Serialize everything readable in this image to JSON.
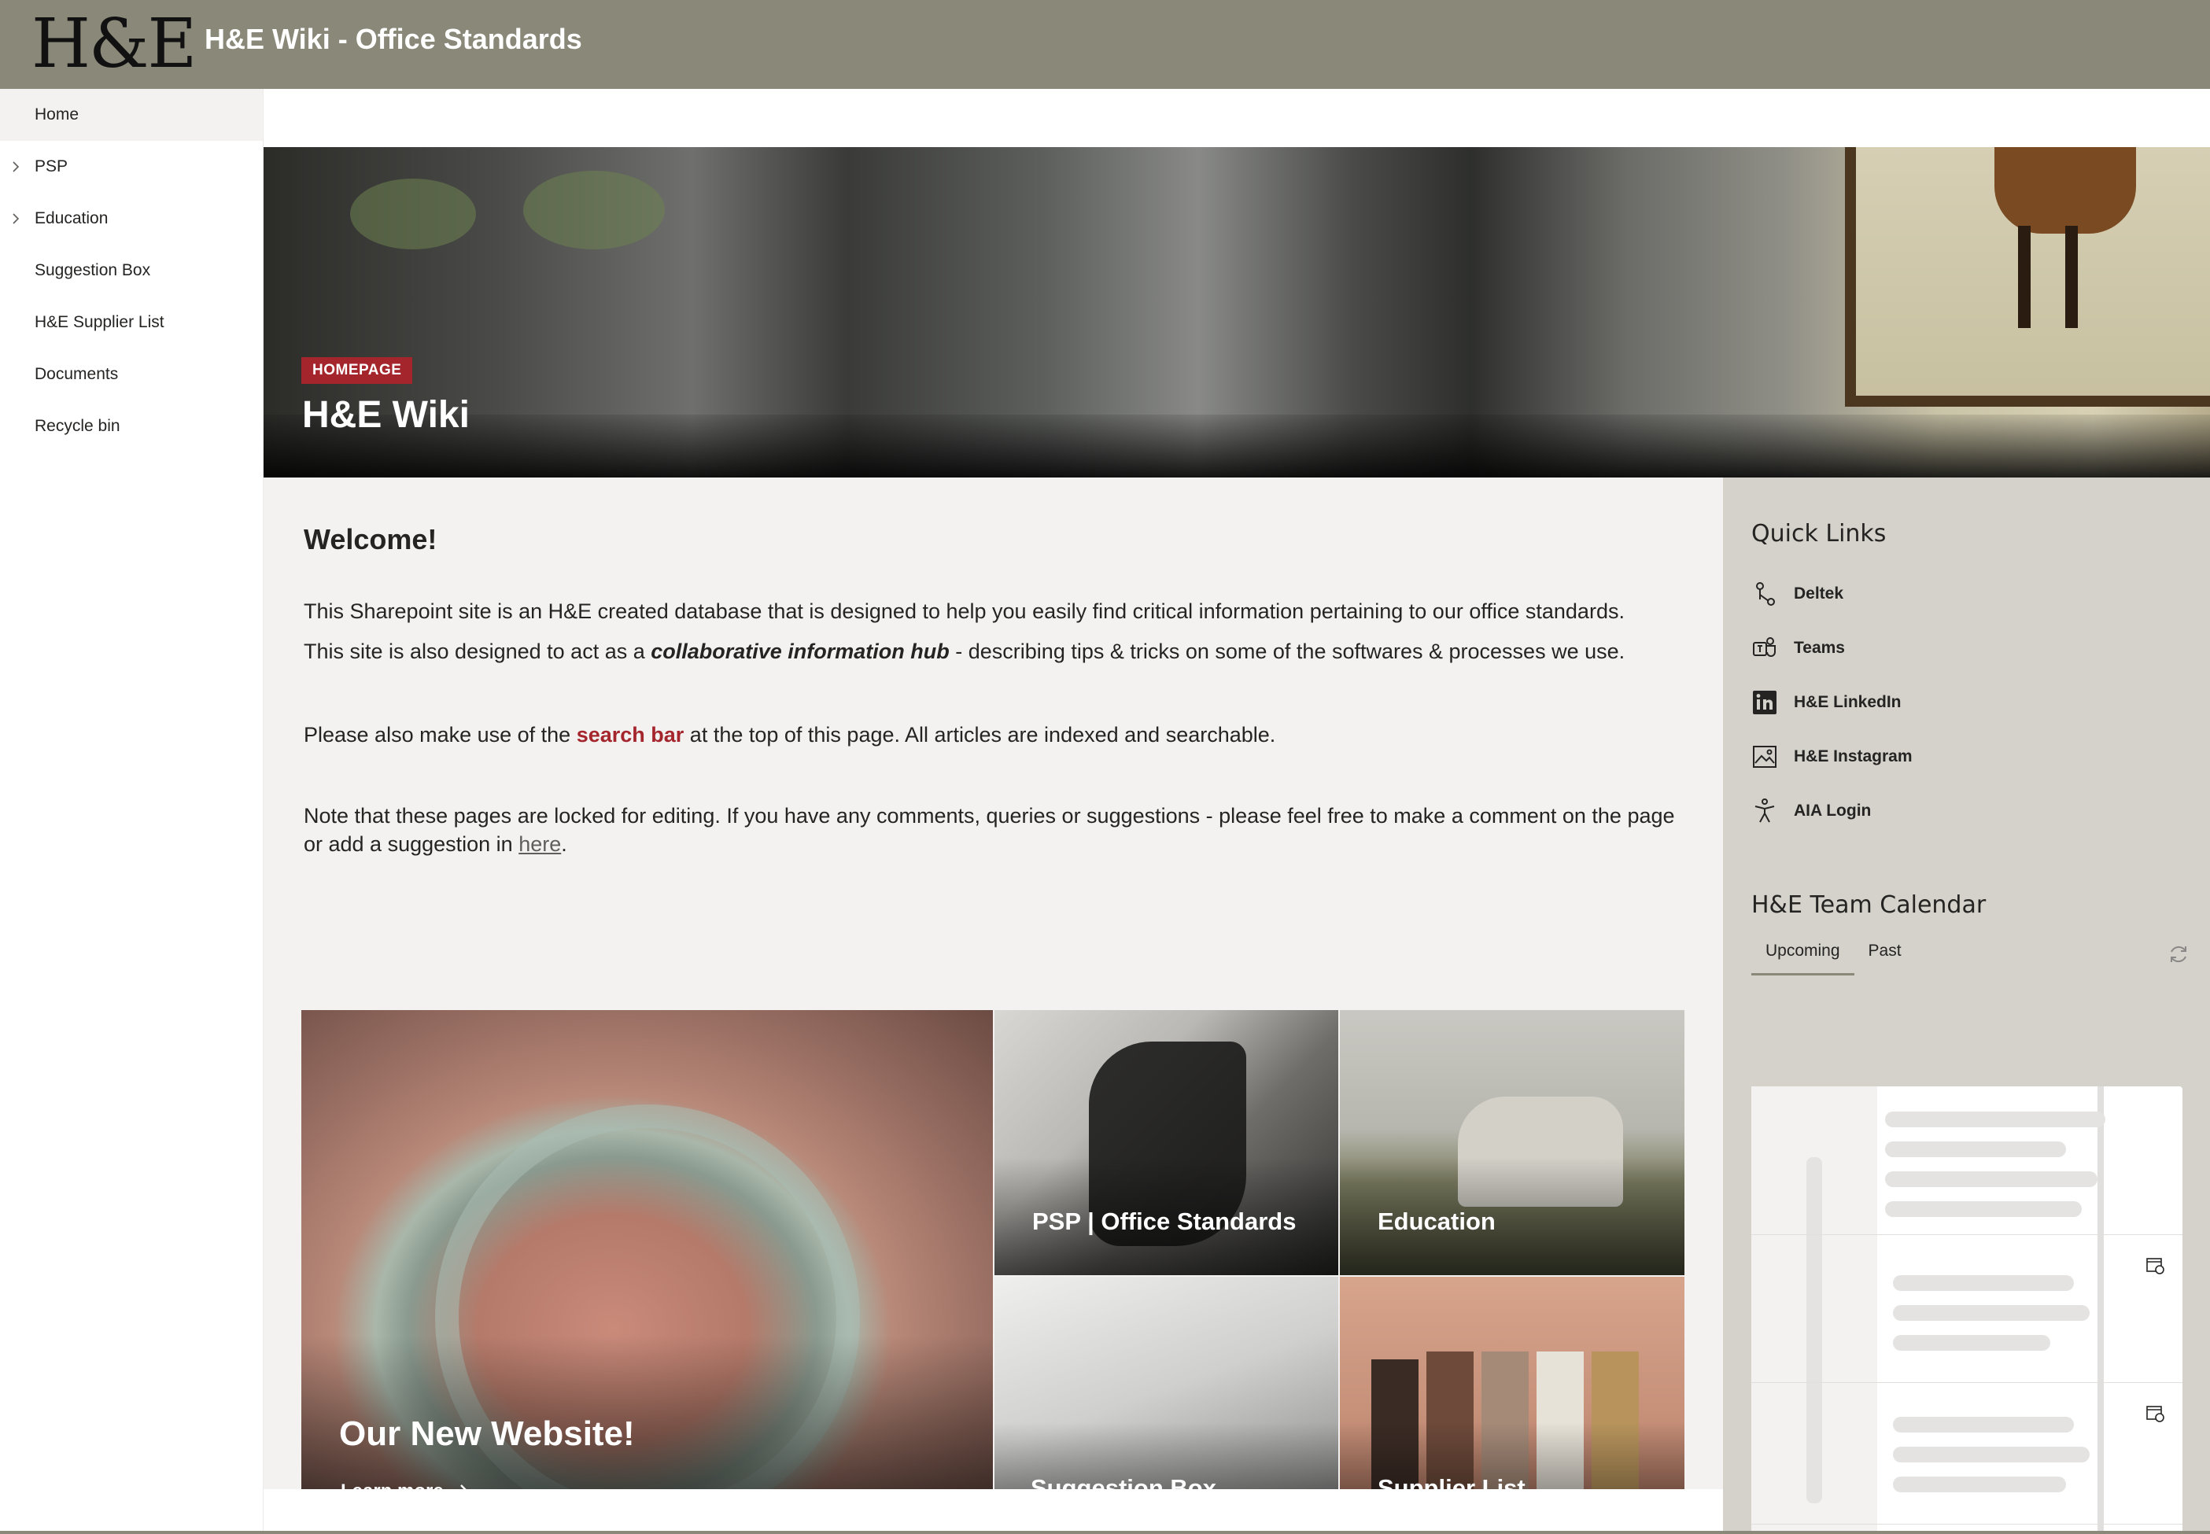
{
  "header": {
    "logo_text": "H&E",
    "site_title": "H&E Wiki - Office Standards"
  },
  "nav": {
    "items": [
      {
        "label": "Home",
        "active": true,
        "expandable": false
      },
      {
        "label": "PSP",
        "active": false,
        "expandable": true
      },
      {
        "label": "Education",
        "active": false,
        "expandable": true
      },
      {
        "label": "Suggestion Box",
        "active": false,
        "expandable": false
      },
      {
        "label": "H&E Supplier List",
        "active": false,
        "expandable": false
      },
      {
        "label": "Documents",
        "active": false,
        "expandable": false
      },
      {
        "label": "Recycle bin",
        "active": false,
        "expandable": false
      }
    ]
  },
  "hero": {
    "badge": "HOMEPAGE",
    "title": "H&E Wiki"
  },
  "content": {
    "welcome": "Welcome!",
    "p1_line1": "This Sharepoint site is an H&E created database that is designed to help you easily find critical information pertaining to our office standards.",
    "p1_line2_before": "This site is also designed to act as a ",
    "p1_line2_em": "collaborative information hub",
    "p1_line2_after": " - describing tips & tricks on some of the softwares & processes we use.",
    "p2_before": "Please also make use of the ",
    "p2_highlight": "search bar",
    "p2_after": " at the top of this page. All articles are indexed and searchable.",
    "p3_line1": "Note that these pages are locked for editing. If you have any comments, queries or suggestions - please feel free to make a comment on the page",
    "p3_line2_before": "or add a suggestion in ",
    "p3_link": "here",
    "p3_line2_after": "."
  },
  "tiles": {
    "big": {
      "label": "Our New Website!",
      "cta": "Learn more"
    },
    "psp": {
      "label": "PSP | Office Standards"
    },
    "education": {
      "label": "Education"
    },
    "suggestion": {
      "label": "Suggestion Box"
    },
    "supplier": {
      "label": "Supplier List"
    }
  },
  "quick_links": {
    "title": "Quick Links",
    "items": [
      {
        "label": "Deltek",
        "icon": "deltek-icon"
      },
      {
        "label": "Teams",
        "icon": "teams-icon"
      },
      {
        "label": "H&E LinkedIn",
        "icon": "linkedin-icon"
      },
      {
        "label": "H&E Instagram",
        "icon": "image-icon"
      },
      {
        "label": "AIA Login",
        "icon": "accessibility-icon"
      }
    ]
  },
  "calendar": {
    "title": "H&E Team Calendar",
    "tabs": [
      "Upcoming",
      "Past"
    ],
    "active_tab": "Upcoming"
  },
  "colors": {
    "header_bg": "#8a8878",
    "accent_red": "#a4262c",
    "panel_bg": "#d4d2cb",
    "content_bg": "#f3f2f1"
  }
}
